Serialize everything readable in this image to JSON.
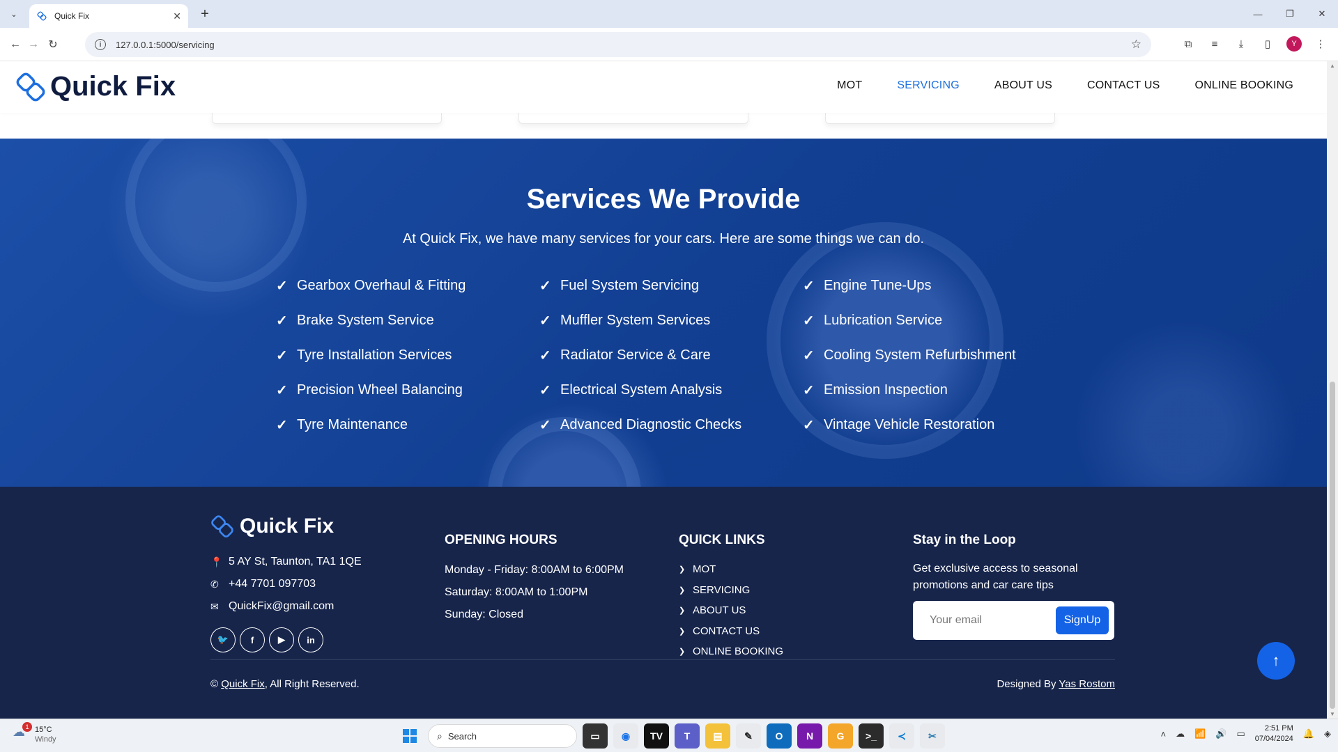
{
  "browser": {
    "tab_title": "Quick Fix",
    "url": "127.0.0.1:5000/servicing",
    "profile_initial": "Y"
  },
  "site": {
    "brand": "Quick Fix",
    "nav": [
      {
        "label": "MOT",
        "active": false
      },
      {
        "label": "SERVICING",
        "active": true
      },
      {
        "label": "ABOUT US",
        "active": false
      },
      {
        "label": "CONTACT US",
        "active": false
      },
      {
        "label": "ONLINE BOOKING",
        "active": false
      }
    ]
  },
  "services": {
    "title": "Services We Provide",
    "subtitle": "At Quick Fix, we have many services for your cars. Here are some things we can do.",
    "columns": [
      [
        "Gearbox Overhaul & Fitting",
        "Brake System Service",
        "Tyre Installation Services",
        "Precision Wheel Balancing",
        "Tyre Maintenance"
      ],
      [
        "Fuel System Servicing",
        "Muffler System Services",
        "Radiator Service & Care",
        "Electrical System Analysis",
        "Advanced Diagnostic Checks"
      ],
      [
        "Engine Tune-Ups",
        "Lubrication Service",
        "Cooling System Refurbishment",
        "Emission Inspection",
        "Vintage Vehicle Restoration"
      ]
    ]
  },
  "footer": {
    "brand": "Quick Fix",
    "address": "5 AY St, Taunton, TA1 1QE",
    "phone": "+44 7701 097703",
    "email": "QuickFix@gmail.com",
    "socials": [
      "twitter-icon",
      "facebook-icon",
      "youtube-icon",
      "linkedin-icon"
    ],
    "hours_title": "OPENING HOURS",
    "hours": [
      "Monday - Friday: 8:00AM to 6:00PM",
      "Saturday: 8:00AM to 1:00PM",
      "Sunday: Closed"
    ],
    "links_title": "QUICK LINKS",
    "links": [
      "MOT",
      "SERVICING",
      "ABOUT US",
      "CONTACT US",
      "ONLINE BOOKING"
    ],
    "loop_title": "Stay in the Loop",
    "loop_text": "Get exclusive access to seasonal promotions and car care tips",
    "email_placeholder": "Your email",
    "signup_label": "SignUp",
    "copyright_prefix": "©",
    "copyright_link": "Quick Fix",
    "copyright_suffix": ", All Right Reserved.",
    "designed_prefix": "Designed By",
    "designed_link": "Yas Rostom"
  },
  "taskbar": {
    "temperature": "15°C",
    "weather": "Windy",
    "weather_badge": "1",
    "search_placeholder": "Search",
    "time": "2:51 PM",
    "date": "07/04/2024"
  },
  "colors": {
    "accent": "#1d6fe0",
    "footer_bg": "#17254b",
    "services_bg": "#123f92",
    "button": "#1463e6"
  }
}
